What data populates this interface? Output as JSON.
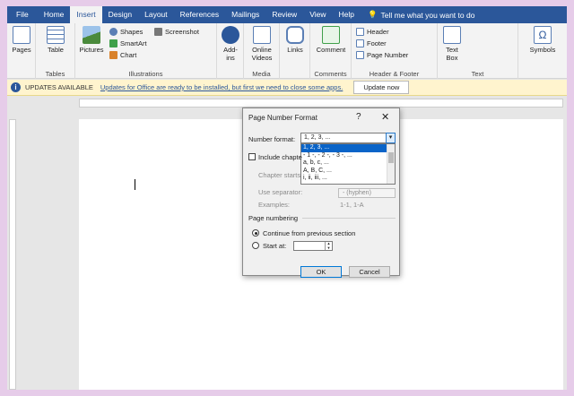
{
  "ribbon_tabs": [
    "File",
    "Home",
    "Insert",
    "Design",
    "Layout",
    "References",
    "Mailings",
    "Review",
    "View",
    "Help"
  ],
  "active_tab": "Insert",
  "tell_me": "Tell me what you want to do",
  "groups": {
    "pages": {
      "label": "Pages"
    },
    "tables": {
      "button": "Table",
      "label": "Tables"
    },
    "illustrations": {
      "pictures": "Pictures",
      "shapes": "Shapes",
      "smartart": "SmartArt",
      "chart": "Chart",
      "screenshot": "Screenshot",
      "label": "Illustrations"
    },
    "addins": {
      "button_line1": "Add-",
      "button_line2": "ins"
    },
    "media": {
      "line1": "Online",
      "line2": "Videos",
      "label": "Media"
    },
    "links": {
      "button": "Links"
    },
    "comments": {
      "button": "Comment",
      "label": "Comments"
    },
    "header_footer": {
      "header": "Header",
      "footer": "Footer",
      "page_number": "Page Number",
      "label": "Header & Footer"
    },
    "text": {
      "line1": "Text",
      "line2": "Box",
      "label": "Text"
    },
    "symbols": {
      "button": "Symbols"
    }
  },
  "update_bar": {
    "title": "UPDATES AVAILABLE",
    "message": "Updates for Office are ready to be installed, but first we need to close some apps.",
    "button": "Update now"
  },
  "dialog": {
    "title": "Page Number Format",
    "help": "?",
    "close": "✕",
    "number_format_label": "Number format:",
    "number_format_value": "1, 2, 3, ...",
    "format_options": [
      "1, 2, 3, ...",
      "- 1 -, - 2 -, - 3 -, ...",
      "a, b, c, ...",
      "A, B, C, ...",
      "i, ii, iii, ..."
    ],
    "selected_index": 0,
    "include_chapter_label": "Include chapte",
    "chapter_starts_label": "Chapter starts",
    "use_separator_label": "Use separator:",
    "separator_value": "-  (hyphen)",
    "examples_label": "Examples:",
    "examples_value": "1-1, 1-A",
    "page_numbering_label": "Page numbering",
    "continue_label": "Continue from previous section",
    "start_at_label": "Start at:",
    "ok": "OK",
    "cancel": "Cancel"
  }
}
